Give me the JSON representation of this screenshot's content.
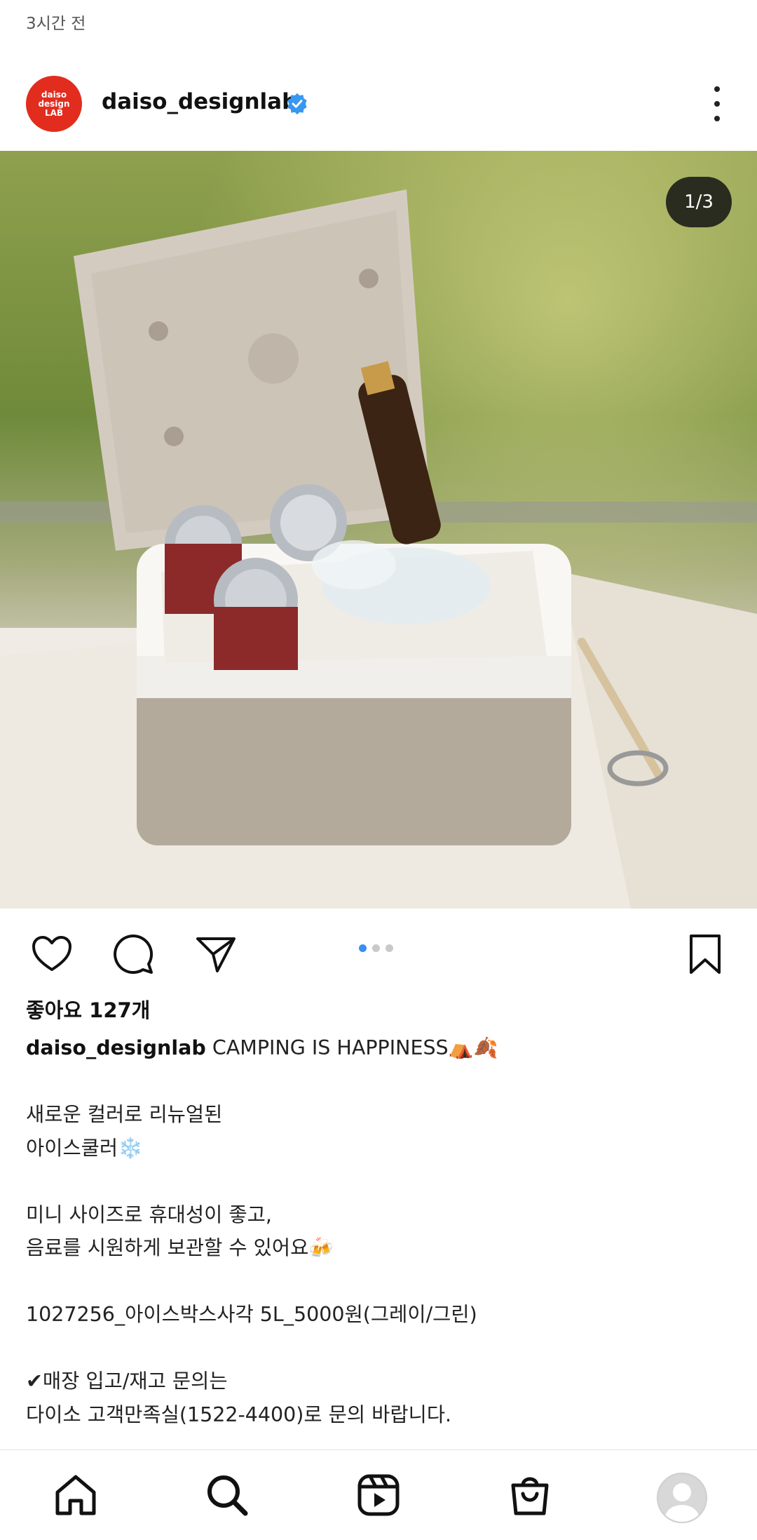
{
  "post": {
    "timestamp": "3시간 전",
    "author": {
      "username": "daiso_designlab",
      "avatar_text": [
        "daiso",
        "design",
        "LAB"
      ],
      "avatar_color": "#e22c1e",
      "verified": true
    },
    "carousel": {
      "counter": "1/3",
      "current": 1,
      "total": 3
    },
    "likes": "좋아요 127개",
    "caption": {
      "username": "daiso_designlab",
      "first_line": "CAMPING IS HAPPINESS⛺🍂",
      "lines": [
        "",
        "새로운 컬러로 리뉴얼된",
        "아이스쿨러❄️",
        "",
        "미니 사이즈로 휴대성이 좋고,",
        "음료를 시원하게 보관할 수 있어요🍻",
        "",
        "1027256_아이스박스사각 5L_5000원(그레이/그린)",
        "",
        "✔매장 입고/재고 문의는",
        "다이소 고객만족실(1522-4400)로 문의 바랍니다."
      ]
    }
  },
  "actions": [
    "heart-icon",
    "comment-icon",
    "share-icon",
    "bookmark-icon"
  ],
  "nav": [
    "home-icon",
    "search-icon",
    "reels-icon",
    "shop-icon",
    "profile-avatar"
  ],
  "colors": {
    "verified": "#3897f0",
    "dot_active": "#3a8ef6"
  }
}
